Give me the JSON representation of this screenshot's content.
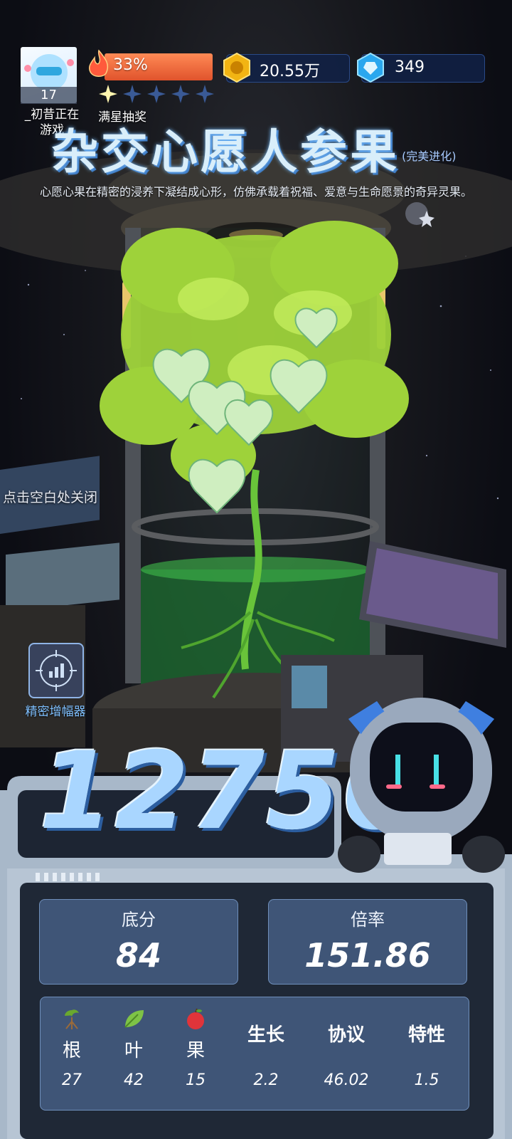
{
  "player": {
    "level": "17",
    "name": "_初昔正在\n游戏",
    "energy_percent": "33%",
    "energy_fraction": 0.33,
    "stars_filled": 1,
    "stars_total": 5,
    "lottery_label": "满星抽奖"
  },
  "currencies": [
    {
      "icon": "gold-coin-icon",
      "amount": "20.55万"
    },
    {
      "icon": "blue-gem-icon",
      "amount": "349"
    }
  ],
  "item": {
    "title": "杂交心愿人参果",
    "suffix": "(完美进化)",
    "description": "心愿心果在精密的浸养下凝结成心形，仿佛承载着祝福、爱意与生命愿景的奇异灵果。"
  },
  "close_hint": "点击空白处关闭",
  "amplifier_label": "精密增幅器",
  "score": {
    "total": "12756",
    "base_label": "底分",
    "base_value": "84",
    "multiplier_label": "倍率",
    "multiplier_value": "151.86"
  },
  "attributes": [
    {
      "icon": "root-sprout-icon",
      "name": "根",
      "value": "27"
    },
    {
      "icon": "leaf-icon",
      "name": "叶",
      "value": "42"
    },
    {
      "icon": "apple-icon",
      "name": "果",
      "value": "15"
    },
    {
      "name": "生长",
      "value": "2.2"
    },
    {
      "name": "协议",
      "value": "46.02"
    },
    {
      "name": "特性",
      "value": "1.5"
    }
  ]
}
